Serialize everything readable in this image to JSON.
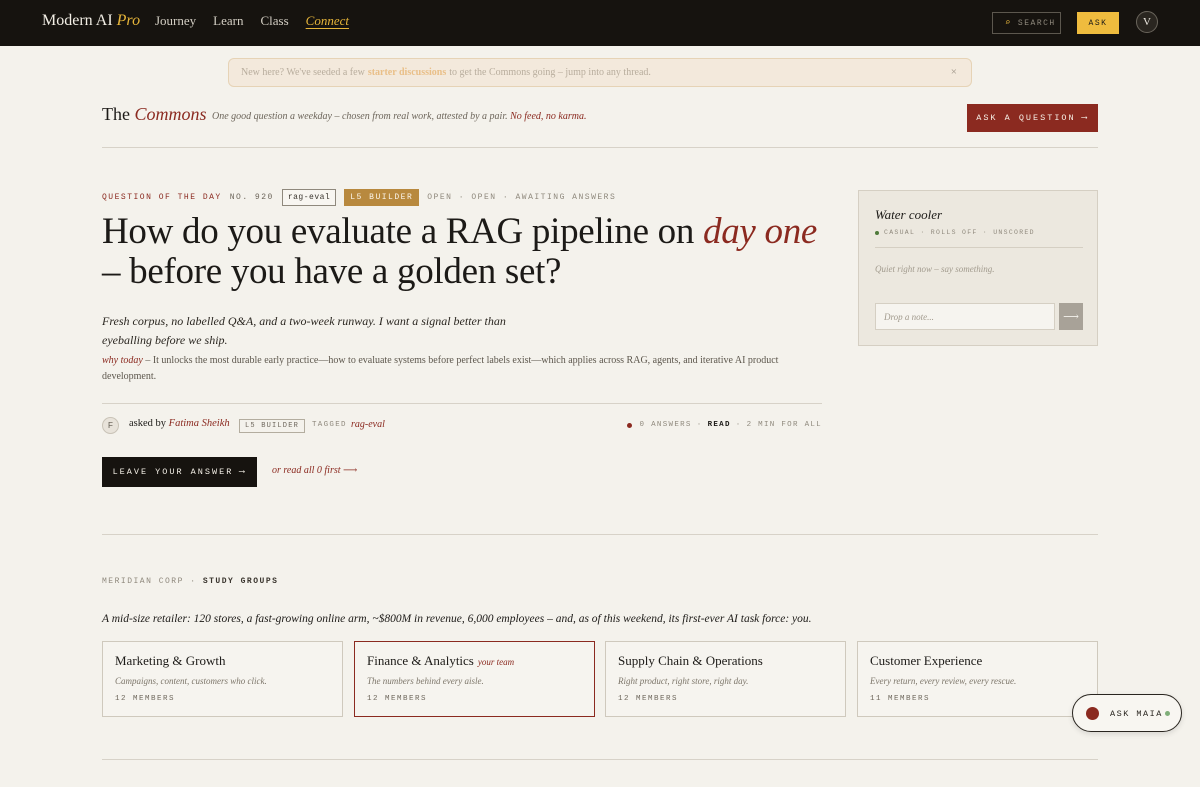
{
  "nav": {
    "brand": "Modern AI",
    "brand_accent": "Pro",
    "links": [
      "Journey",
      "Learn",
      "Class",
      "Connect"
    ],
    "active": "Connect",
    "search_label": "SEARCH",
    "ask_label": "ASK",
    "avatar_initial": "V"
  },
  "banner": {
    "prefix": "New here? We've seeded a few",
    "link": "starter discussions",
    "suffix": "to get the Commons going – jump into any thread.",
    "close": "×"
  },
  "commons": {
    "title_prefix": "The",
    "title_accent": "Commons",
    "tagline": "One good question a weekday – chosen from real work, attested by a pair.",
    "tagline_accent": "No feed, no karma.",
    "ask_button": "ASK A QUESTION"
  },
  "qotd": {
    "label": "QUESTION OF THE DAY",
    "number": "NO. 920",
    "tag_chip": "rag-eval",
    "level_chip": "L5 BUILDER",
    "status": "OPEN · OPEN · AWAITING ANSWERS",
    "headline_a": "How do you evaluate a RAG pipeline on",
    "headline_accent": "day one",
    "headline_b": "– before you have a golden set?",
    "lede": "Fresh corpus, no labelled Q&A, and a two-week runway. I want a signal better than eyeballing before we ship.",
    "why_label": "why today",
    "why_text": "– It unlocks the most durable early practice—how to evaluate systems before perfect labels exist—which applies across RAG, agents, and iterative AI product development.",
    "asker_initial": "F",
    "asked_by_label": "asked by",
    "asker_name": "Fatima Sheikh",
    "asker_level": "L5 BUILDER",
    "tagged_label": "TAGGED",
    "tag": "rag-eval",
    "answers": "0 ANSWERS",
    "read_label": "READ",
    "read_time": "2 MIN FOR ALL",
    "leave_button": "LEAVE YOUR ANSWER",
    "read_all_link": "or read all 0 first"
  },
  "water_cooler": {
    "title": "Water cooler",
    "meta": "CASUAL · ROLLS OFF · UNSCORED",
    "status_color": "#4f7a3b",
    "quiet": "Quiet right now – say something.",
    "input_placeholder": "Drop a note...",
    "send_icon": "arrow-right-icon"
  },
  "study_groups": {
    "org": "MERIDIAN CORP",
    "section": "STUDY GROUPS",
    "intro": "A mid-size retailer: 120 stores, a fast-growing online arm, ~$800M in revenue, 6,000 employees – and, as of this weekend, its first-ever AI task force: you.",
    "groups": [
      {
        "name": "Marketing & Growth",
        "desc": "Campaigns, content, customers who click.",
        "members": "12 MEMBERS",
        "badge": ""
      },
      {
        "name": "Finance & Analytics",
        "desc": "The numbers behind every aisle.",
        "members": "12 MEMBERS",
        "badge": "your team"
      },
      {
        "name": "Supply Chain & Operations",
        "desc": "Right product, right store, right day.",
        "members": "12 MEMBERS",
        "badge": ""
      },
      {
        "name": "Customer Experience",
        "desc": "Every return, every review, every rescue.",
        "members": "11 MEMBERS",
        "badge": ""
      }
    ]
  },
  "maia": {
    "label": "ASK MAIA"
  },
  "colors": {
    "accent_red": "#8b2a20",
    "accent_gold": "#e6b53a",
    "background": "#f4f2ec",
    "nav_bg": "#16130f"
  }
}
